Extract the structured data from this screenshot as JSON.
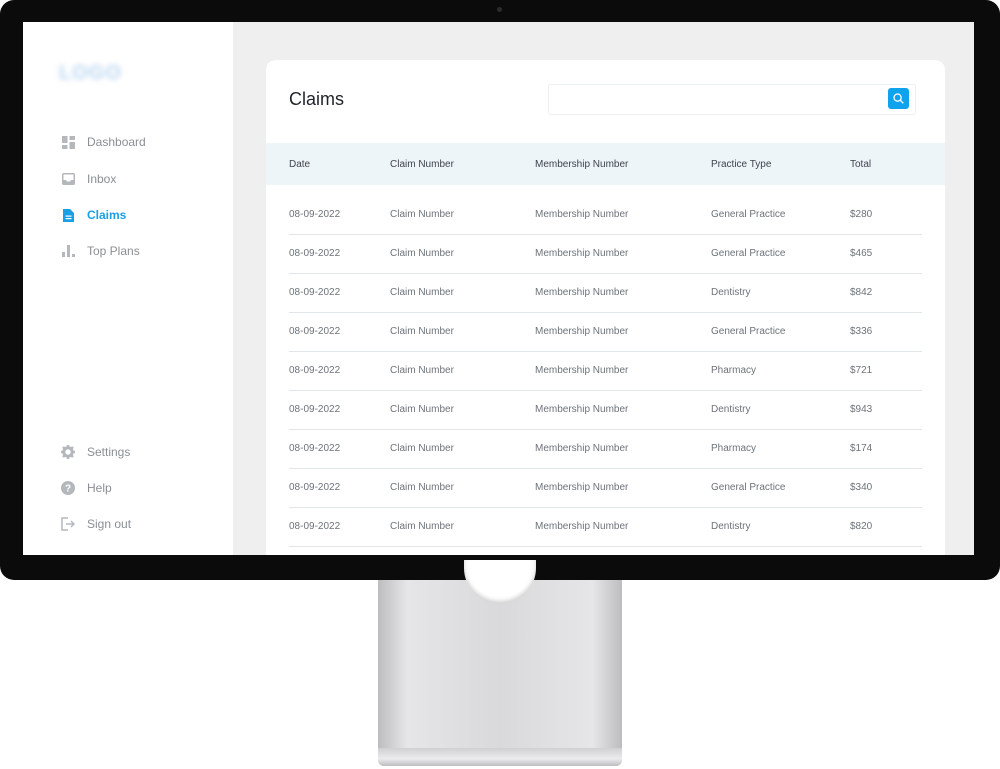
{
  "sidebar": {
    "logo_text": "LOGO",
    "nav": [
      {
        "label": "Dashboard",
        "icon": "dashboard-icon",
        "active": false
      },
      {
        "label": "Inbox",
        "icon": "inbox-icon",
        "active": false
      },
      {
        "label": "Claims",
        "icon": "document-icon",
        "active": true
      },
      {
        "label": "Top Plans",
        "icon": "bar-chart-icon",
        "active": false
      }
    ],
    "bottom_nav": [
      {
        "label": "Settings",
        "icon": "gear-icon"
      },
      {
        "label": "Help",
        "icon": "help-icon"
      },
      {
        "label": "Sign out",
        "icon": "sign-out-icon"
      }
    ]
  },
  "main": {
    "title": "Claims",
    "search": {
      "placeholder": "",
      "value": ""
    },
    "table": {
      "columns": [
        "Date",
        "Claim Number",
        "Membership Number",
        "Practice Type",
        "Total"
      ],
      "rows": [
        [
          "08-09-2022",
          "Claim Number",
          "Membership Number",
          "General Practice",
          "$280"
        ],
        [
          "08-09-2022",
          "Claim Number",
          "Membership Number",
          "General Practice",
          "$465"
        ],
        [
          "08-09-2022",
          "Claim Number",
          "Membership Number",
          "Dentistry",
          "$842"
        ],
        [
          "08-09-2022",
          "Claim Number",
          "Membership Number",
          "General Practice",
          "$336"
        ],
        [
          "08-09-2022",
          "Claim Number",
          "Membership Number",
          "Pharmacy",
          "$721"
        ],
        [
          "08-09-2022",
          "Claim Number",
          "Membership Number",
          "Dentistry",
          "$943"
        ],
        [
          "08-09-2022",
          "Claim Number",
          "Membership Number",
          "Pharmacy",
          "$174"
        ],
        [
          "08-09-2022",
          "Claim Number",
          "Membership Number",
          "General Practice",
          "$340"
        ],
        [
          "08-09-2022",
          "Claim Number",
          "Membership Number",
          "Dentistry",
          "$820"
        ]
      ]
    }
  },
  "colors": {
    "accent": "#1a9ee6",
    "search_button": "#0fa3ee",
    "table_header_bg": "#eef5f8",
    "background": "#efefef"
  }
}
